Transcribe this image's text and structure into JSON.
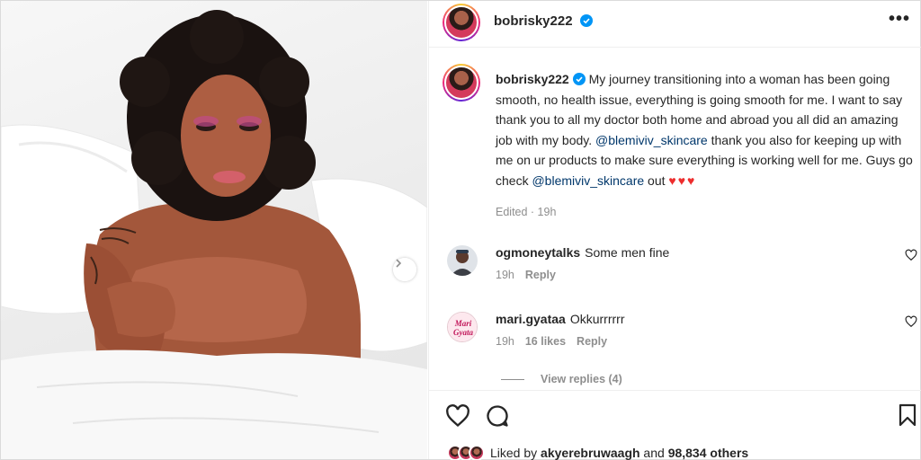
{
  "header": {
    "username": "bobrisky222",
    "more_label": "•••"
  },
  "caption": {
    "username": "bobrisky222",
    "text_part1": "My journey transitioning into a woman has been going smooth, no health issue, everything is going smooth for me. I want to say thank you to all my doctor both home and abroad you all did an amazing job with my body. ",
    "mention1": "@blemiviv_skincare",
    "text_part2": " thank you also for keeping up with me on ur products to make sure everything is working well for me. Guys go check ",
    "mention2": "@blemiviv_skincare",
    "text_part3": " out ",
    "hearts": "♥♥♥",
    "edited": "Edited · 19h"
  },
  "comments": [
    {
      "username": "ogmoneytalks",
      "text": "Some men fine",
      "time": "19h",
      "likes": "",
      "reply": "Reply"
    },
    {
      "username": "mari.gyataa",
      "text": "Okkurrrrrr",
      "time": "19h",
      "likes": "16 likes",
      "reply": "Reply",
      "avatar_text": "Mari Gyata"
    }
  ],
  "view_replies": "View replies (4)",
  "likes": {
    "prefix": "Liked by ",
    "user": "akyerebruwaagh",
    "middle": " and ",
    "count": "98,834 others"
  },
  "icons": {
    "verified": "verified-badge-icon",
    "like": "heart-icon",
    "comment": "comment-icon",
    "save": "bookmark-icon",
    "next": "chevron-right-icon"
  },
  "colors": {
    "verified": "#0095f6",
    "mention": "#00376b",
    "heart": "#ed2d2d",
    "muted": "#8e8e8e"
  }
}
